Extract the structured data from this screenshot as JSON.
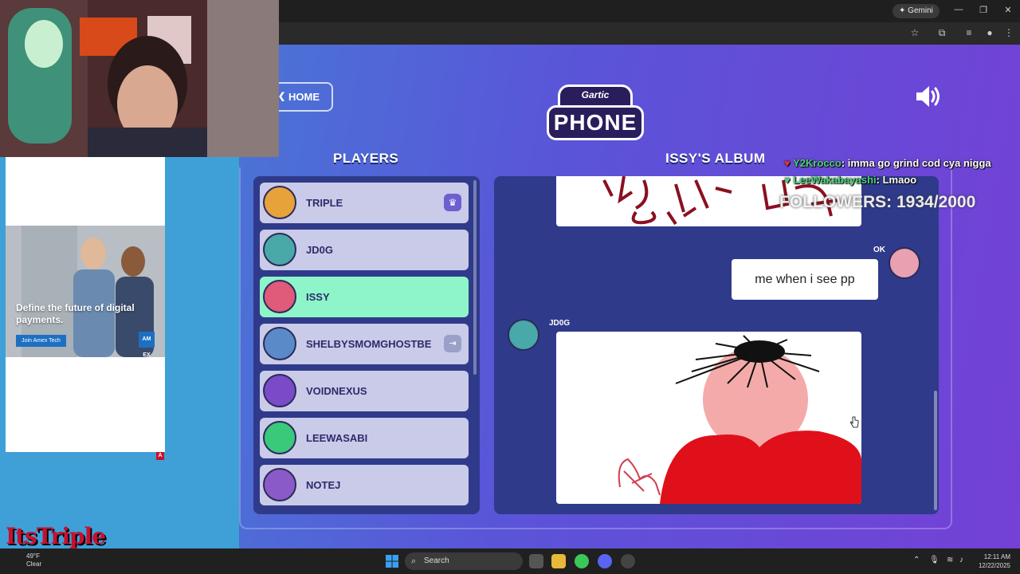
{
  "browser": {
    "gemini_label": "Gemini",
    "gemini_icon": "sparkle-icon",
    "window_controls": [
      "—",
      "❐",
      "✕"
    ]
  },
  "game": {
    "home_label": "HOME",
    "logo_top": "Gartic",
    "logo_main": "PHONE",
    "players_title": "PLAYERS",
    "album_title": "ISSY'S ALBUM",
    "players": [
      {
        "name": "TRIPLE",
        "badge": "crown-icon",
        "active": false,
        "avatar_color": "#e8a23a"
      },
      {
        "name": "JD0G",
        "badge": "",
        "active": false,
        "avatar_color": "#49a8a8"
      },
      {
        "name": "ISSY",
        "badge": "",
        "active": true,
        "avatar_color": "#e05a7a"
      },
      {
        "name": "SHELBYSMOMGHOSTBE",
        "badge": "exit-icon",
        "active": false,
        "avatar_color": "#5a8ac8"
      },
      {
        "name": "VOIDNEXUS",
        "badge": "",
        "active": false,
        "avatar_color": "#7a4ac8"
      },
      {
        "name": "LEEWASABI",
        "badge": "",
        "active": false,
        "avatar_color": "#3ac87a"
      },
      {
        "name": "NOTEJ",
        "badge": "",
        "active": false,
        "avatar_color": "#8a5ac8"
      }
    ],
    "album": {
      "message_author": "OK",
      "message_text": "me when i see pp",
      "drawing_author": "JD0G"
    }
  },
  "ad": {
    "headline": "Define the future of digital payments.",
    "button_label": "Join Amex Tech",
    "logo_text": "AM EX",
    "corner_badge": "A"
  },
  "overlay": {
    "chat": [
      {
        "user": "Y2Krocco",
        "text": ": imma go grind cod cya nigga"
      },
      {
        "user": "LeeWakabayashi",
        "text": ": Lmaoo"
      }
    ],
    "followers": "FOLLOWERS: 1934/2000",
    "brand": "ItsTriple"
  },
  "taskbar": {
    "weather_temp": "49°F",
    "weather_desc": "Clear",
    "search_placeholder": "Search",
    "time": "12:11 AM",
    "date": "12/22/2025"
  },
  "colors": {
    "accent": "#6c5fd0",
    "active_player": "#8ef5c9",
    "panel": "#2f3a8a"
  }
}
